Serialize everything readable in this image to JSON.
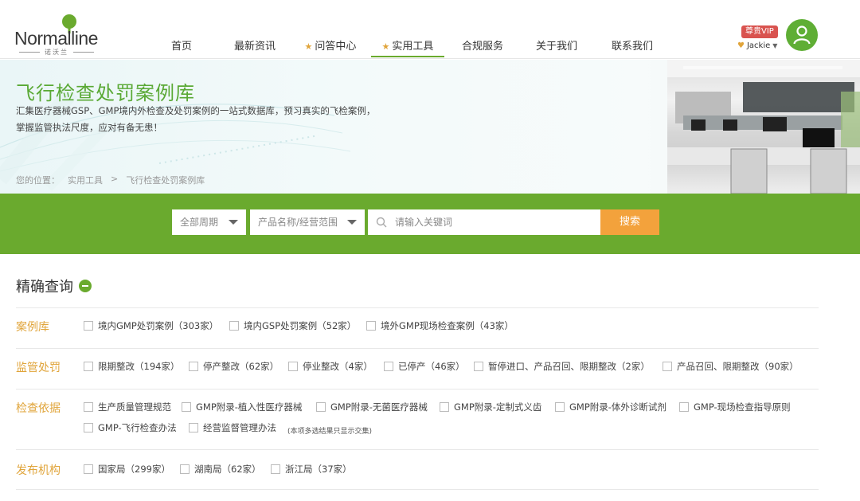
{
  "header": {
    "logo_text": "Normalline",
    "logo_sub": "诺沃兰",
    "nav": [
      {
        "label": "首页",
        "star": false,
        "active": false
      },
      {
        "label": "最新资讯",
        "star": false,
        "active": false
      },
      {
        "label": "问答中心",
        "star": true,
        "active": false
      },
      {
        "label": "实用工具",
        "star": true,
        "active": true
      },
      {
        "label": "合规服务",
        "star": false,
        "active": false
      },
      {
        "label": "关于我们",
        "star": false,
        "active": false
      },
      {
        "label": "联系我们",
        "star": false,
        "active": false
      }
    ],
    "vip_badge": "尊贵VIP",
    "username": "Jackie",
    "star_glyph": "★",
    "heart_glyph": "♥",
    "caret_glyph": "▼"
  },
  "banner": {
    "title": "飞行检查处罚案例库",
    "desc_line1": "汇集医疗器械GSP、GMP境内外检查及处罚案例的一站式数据库，预习真实的飞检案例，",
    "desc_line2": "掌握监管执法尺度，应对有备无患！",
    "breadcrumb": [
      "您的位置：",
      "实用工具",
      ">",
      "飞行检查处罚案例库"
    ]
  },
  "search": {
    "period_select": "全部周期",
    "scope_select": "产品名称/经营范围",
    "placeholder": "请输入关键词",
    "button": "搜索"
  },
  "filters": {
    "section_title": "精确查询",
    "rows": [
      {
        "label": "案例库",
        "options": [
          "境内GMP处罚案例（303家）",
          "境内GSP处罚案例（52家）",
          "境外GMP现场检查案例（43家）"
        ]
      },
      {
        "label": "监管处罚",
        "options": [
          "限期整改（194家）",
          "停产整改（62家）",
          "停业整改（4家）",
          "已停产（46家）",
          "暂停进口、产品召回、限期整改（2家）",
          "产品召回、限期整改（90家）"
        ]
      },
      {
        "label": "检查依据",
        "options": [
          "生产质量管理规范",
          "GMP附录-植入性医疗器械",
          "GMP附录-无菌医疗器械",
          "GMP附录-定制式义齿",
          "GMP附录-体外诊断试剂",
          "GMP-现场检查指导原则",
          "GMP-飞行检查办法",
          "经营监督管理办法"
        ],
        "note": "(本项多选结果只显示交集)"
      },
      {
        "label": "发布机构",
        "options": [
          "国家局（299家）",
          "湖南局（62家）",
          "浙江局（37家）"
        ]
      }
    ]
  }
}
